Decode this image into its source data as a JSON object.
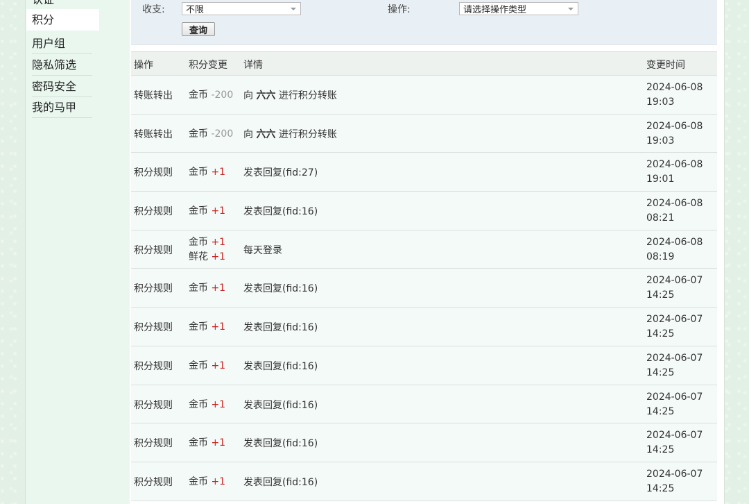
{
  "sidebar": {
    "items": [
      {
        "label": "认证"
      },
      {
        "label": "积分"
      },
      {
        "label": "用户组"
      },
      {
        "label": "隐私筛选"
      },
      {
        "label": "密码安全"
      },
      {
        "label": "我的马甲"
      }
    ]
  },
  "filters": {
    "income_label": "收支:",
    "income_value": "不限",
    "op_label": "操作:",
    "op_value": "请选择操作类型",
    "query_label": "查询"
  },
  "table": {
    "headers": {
      "op": "操作",
      "change": "积分变更",
      "detail": "详情",
      "time": "变更时间"
    },
    "rows": [
      {
        "op": "转账转出",
        "changes": [
          {
            "unit": "金币",
            "amount": "-200"
          }
        ],
        "detail_pre": "向",
        "detail_nick": "六六",
        "detail_post": "进行积分转账",
        "date": "2024-06-08",
        "time": "19:03"
      },
      {
        "op": "转账转出",
        "changes": [
          {
            "unit": "金币",
            "amount": "-200"
          }
        ],
        "detail_pre": "向",
        "detail_nick": "六六",
        "detail_post": "进行积分转账",
        "date": "2024-06-08",
        "time": "19:03"
      },
      {
        "op": "积分规则",
        "changes": [
          {
            "unit": "金币",
            "amount": "+1"
          }
        ],
        "detail": "发表回复(fid:27)",
        "date": "2024-06-08",
        "time": "19:01"
      },
      {
        "op": "积分规则",
        "changes": [
          {
            "unit": "金币",
            "amount": "+1"
          }
        ],
        "detail": "发表回复(fid:16)",
        "date": "2024-06-08",
        "time": "08:21"
      },
      {
        "op": "积分规则",
        "changes": [
          {
            "unit": "金币",
            "amount": "+1"
          },
          {
            "unit": "鲜花",
            "amount": "+1"
          }
        ],
        "detail": "每天登录",
        "date": "2024-06-08",
        "time": "08:19"
      },
      {
        "op": "积分规则",
        "changes": [
          {
            "unit": "金币",
            "amount": "+1"
          }
        ],
        "detail": "发表回复(fid:16)",
        "date": "2024-06-07",
        "time": "14:25"
      },
      {
        "op": "积分规则",
        "changes": [
          {
            "unit": "金币",
            "amount": "+1"
          }
        ],
        "detail": "发表回复(fid:16)",
        "date": "2024-06-07",
        "time": "14:25"
      },
      {
        "op": "积分规则",
        "changes": [
          {
            "unit": "金币",
            "amount": "+1"
          }
        ],
        "detail": "发表回复(fid:16)",
        "date": "2024-06-07",
        "time": "14:25"
      },
      {
        "op": "积分规则",
        "changes": [
          {
            "unit": "金币",
            "amount": "+1"
          }
        ],
        "detail": "发表回复(fid:16)",
        "date": "2024-06-07",
        "time": "14:25"
      },
      {
        "op": "积分规则",
        "changes": [
          {
            "unit": "金币",
            "amount": "+1"
          }
        ],
        "detail": "发表回复(fid:16)",
        "date": "2024-06-07",
        "time": "14:25"
      },
      {
        "op": "积分规则",
        "changes": [
          {
            "unit": "金币",
            "amount": "+1"
          }
        ],
        "detail": "发表回复(fid:16)",
        "date": "2024-06-07",
        "time": "14:25"
      }
    ]
  }
}
